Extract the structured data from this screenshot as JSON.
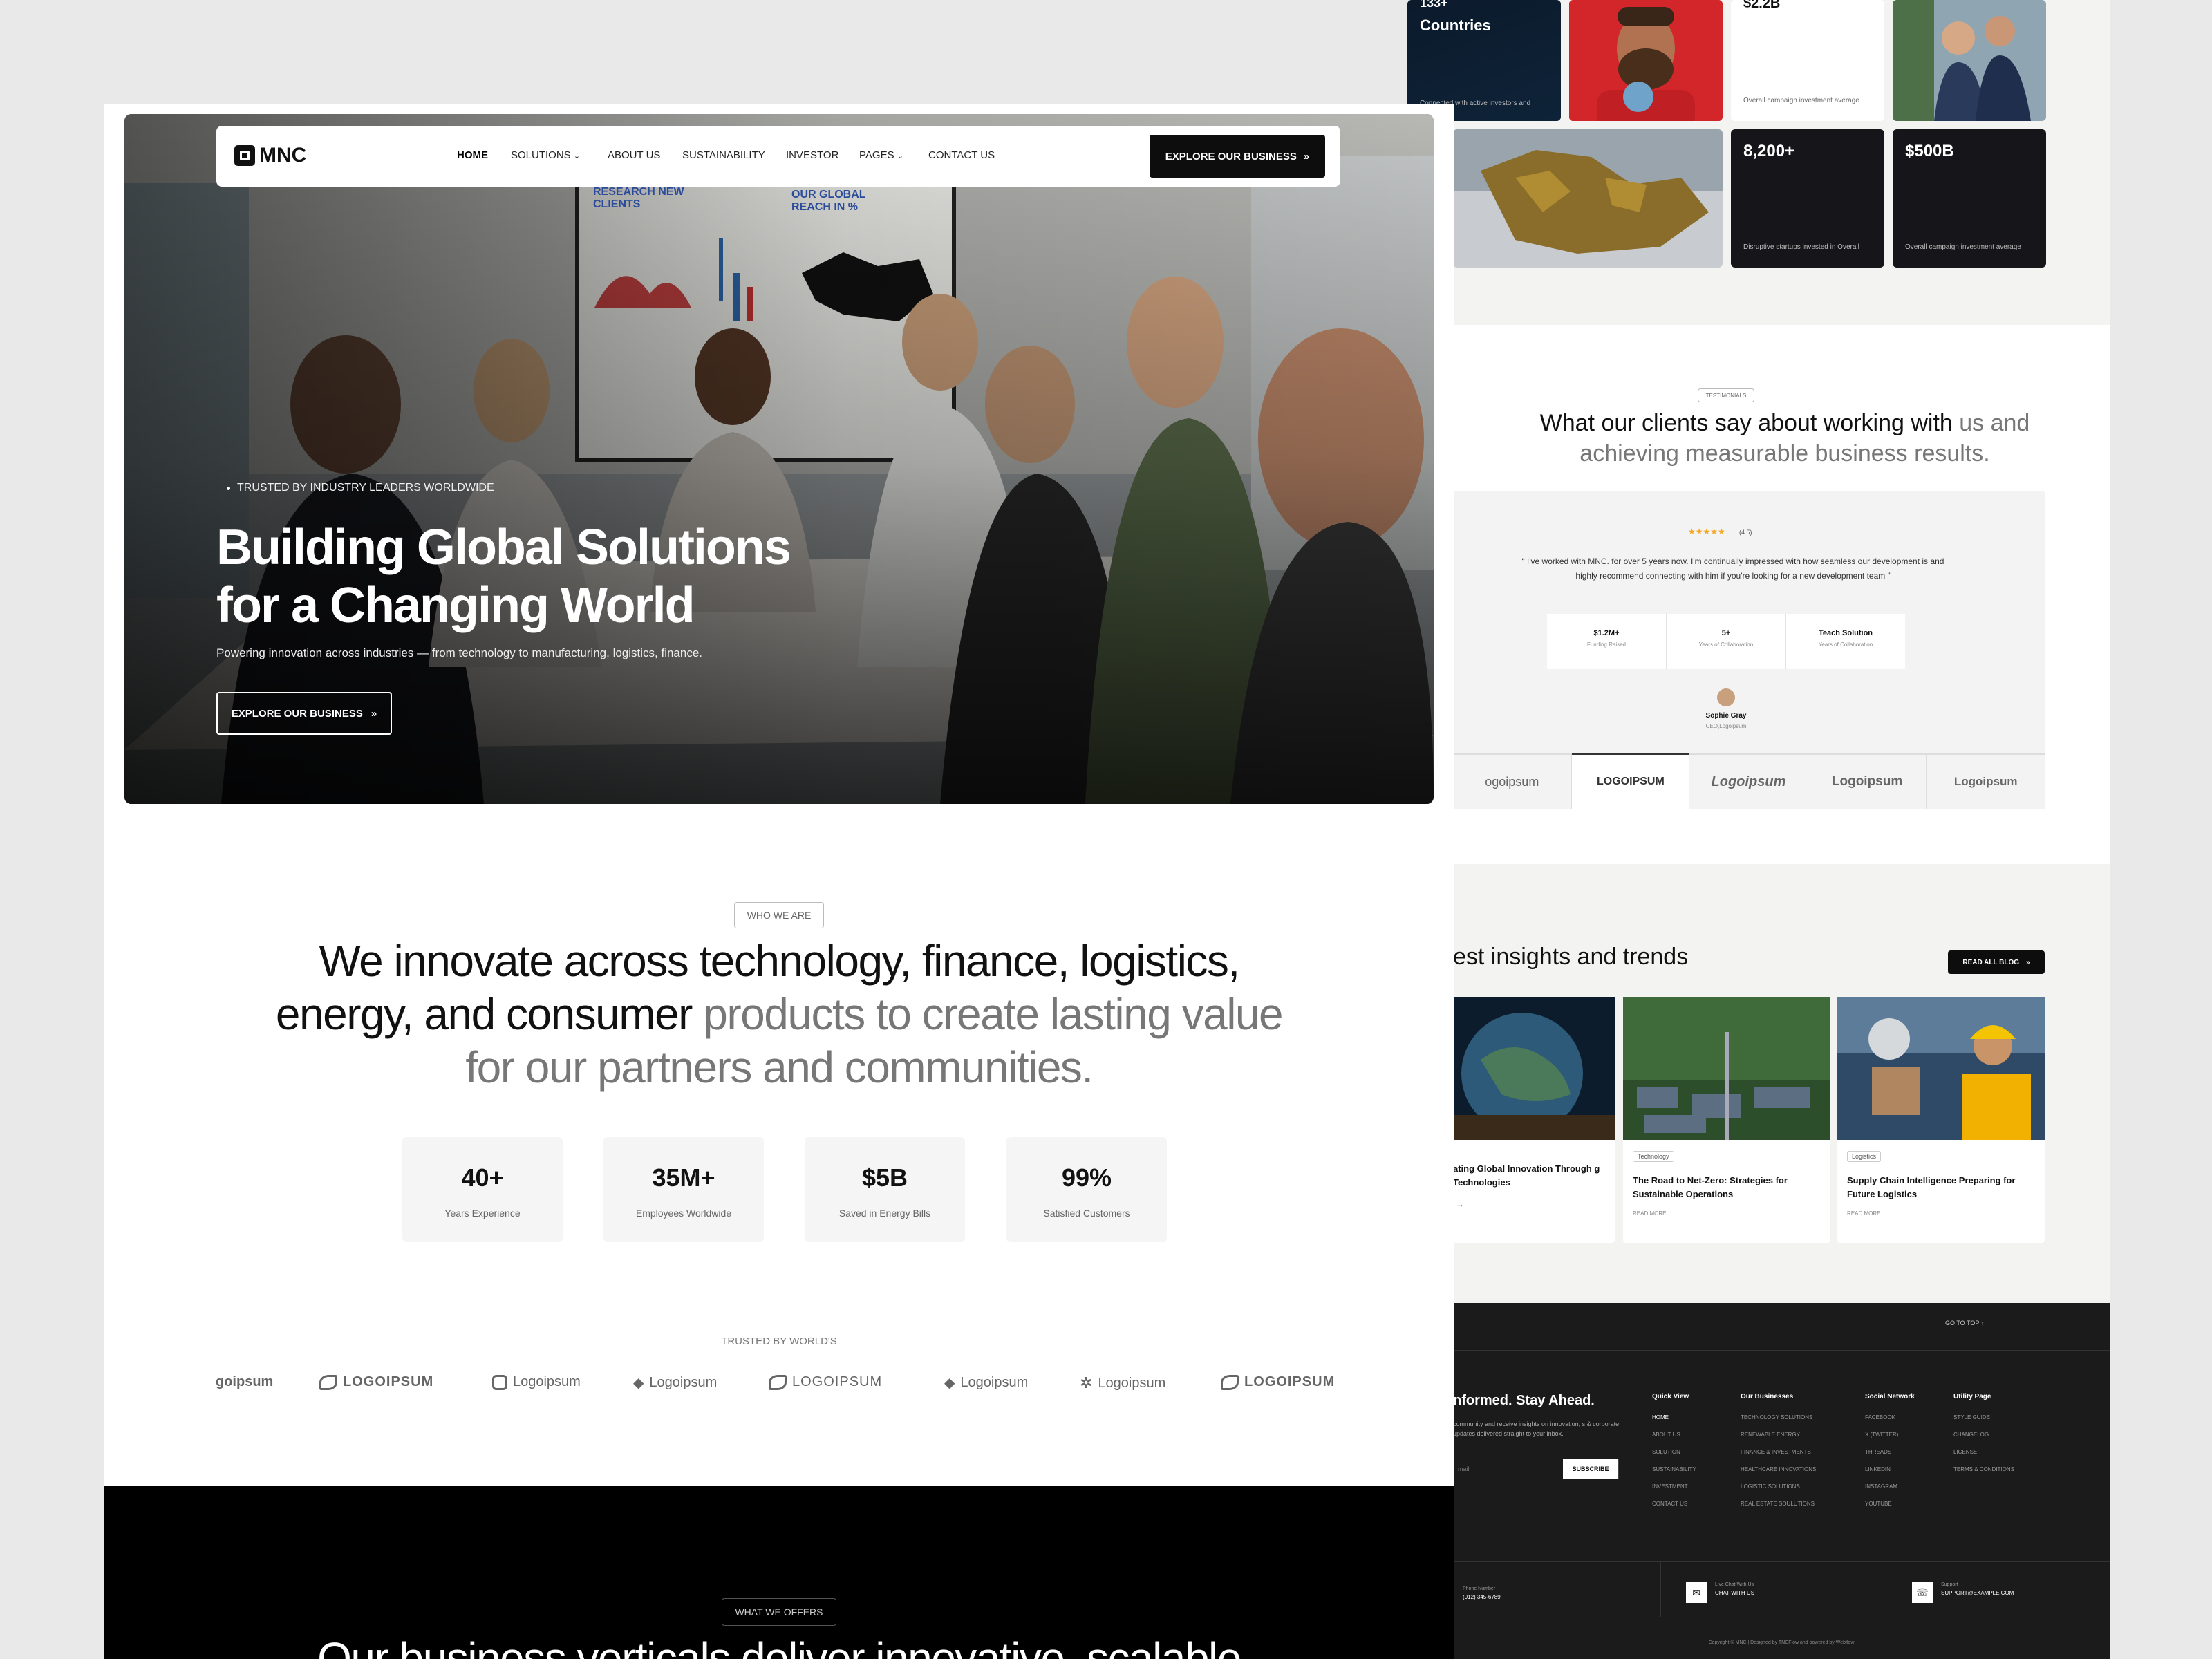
{
  "nav": {
    "brand": "MNC",
    "links": [
      "HOME",
      "SOLUTIONS",
      "ABOUT US",
      "SUSTAINABILITY",
      "INVESTOR",
      "PAGES",
      "CONTACT US"
    ],
    "cta": "EXPLORE OUR BUSINESS"
  },
  "hero": {
    "eyebrow": "TRUSTED BY INDUSTRY LEADERS WORLDWIDE",
    "title_line1": "Building Global Solutions",
    "title_line2": "for a Changing World",
    "subtitle": "Powering innovation across industries — from technology to manufacturing, logistics, finance.",
    "cta": "EXPLORE OUR BUSINESS",
    "board_text1": "RESEARCH NEW CLIENTS",
    "board_text2": "OUR GLOBAL REACH IN %"
  },
  "who": {
    "chip": "WHO WE ARE",
    "line1": "We innovate across technology, finance, logistics,",
    "line2_dark": "energy, and consumer ",
    "line2_light": "products to create lasting value",
    "line3": "for our partners and communities."
  },
  "stats": [
    {
      "value": "40+",
      "label": "Years Experience"
    },
    {
      "value": "35M+",
      "label": "Employees Worldwide"
    },
    {
      "value": "$5B",
      "label": "Saved in Energy Bills"
    },
    {
      "value": "99%",
      "label": "Satisfied Customers"
    }
  ],
  "trusted": {
    "label": "TRUSTED BY WORLD'S",
    "logos": [
      "goipsum",
      "LOGOIPSUM",
      "Logoipsum",
      "Logoipsum",
      "LOGOIPSUM",
      "Logoipsum",
      "Logoipsum",
      "LOGOIPSUM"
    ]
  },
  "offers": {
    "chip": "WHAT WE OFFERS",
    "title": "Our business verticals deliver innovative, scalable"
  },
  "right": {
    "tiles": [
      {
        "value": "133+",
        "label": "Countries",
        "sub": "Connected with active investors and founders"
      },
      {
        "value": "$2.2B",
        "sub": "Overall campaign investment average"
      },
      {
        "value": "8,200+",
        "sub": "Disruptive startups invested in Overall"
      },
      {
        "value": "$500B",
        "sub": "Overall campaign investment average"
      }
    ],
    "testimonials": {
      "chip": "TESTIMONIALS",
      "title_dark": "What our clients say about working with ",
      "title_light": "us and",
      "title_line2": "achieving measurable business results.",
      "rating": "(4.5)",
      "quote": "“ I've worked with MNC. for over 5 years now. I'm continually impressed with how seamless our development is and highly recommend connecting with him if you're looking for a new development team ”",
      "metrics": [
        {
          "value": "$1.2M+",
          "label": "Funding Raised"
        },
        {
          "value": "5+",
          "label": "Years of Collaboration"
        },
        {
          "value": "Teach Solution",
          "label": "Years of Collaboration"
        }
      ],
      "person": "Sophie Gray",
      "role": "CEO,Logoipsum",
      "logos": [
        "ogoipsum",
        "LOGOIPSUM",
        "Logoipsum",
        "Logoipsum",
        "Logoipsum"
      ]
    },
    "blog": {
      "title": "est insights and trends",
      "button": "READ ALL BLOG",
      "cards": [
        {
          "tag": "",
          "title": "ating Global Innovation Through g Technologies",
          "more": ""
        },
        {
          "tag": "Technology",
          "title": "The Road to Net-Zero: Strategies for Sustainable Operations",
          "more": "READ MORE"
        },
        {
          "tag": "Logistics",
          "title": "Supply Chain Intelligence Preparing for Future Logistics",
          "more": "READ MORE"
        }
      ]
    },
    "footer": {
      "goto": "GO TO TOP",
      "headline": "nformed. Stay Ahead.",
      "blurb": "community and receive insights on innovation, s & corporate updates delivered straight to your inbox.",
      "email_placeholder": "mail",
      "subscribe": "SUBSCRIBE",
      "cols": [
        {
          "title": "Quick View",
          "items": [
            "HOME",
            "ABOUT US",
            "SOLUTION",
            "SUSTAINABILITY",
            "INVESTMENT",
            "CONTACT US"
          ]
        },
        {
          "title": "Our Businesses",
          "items": [
            "TECHNOLOGY SOLUTIONS",
            "RENEWABLE ENERGY",
            "FINANCE & INVESTMENTS",
            "HEALTHCARE INNOVATIONS",
            "LOGISTIC SOLUTIONS",
            "REAL ESTATE SOULUTIONS"
          ]
        },
        {
          "title": "Social Network",
          "items": [
            "FACEBOOK",
            "X (TWITTER)",
            "THREADS",
            "LINKEDIN",
            "INSTAGRAM",
            "YOUTUBE"
          ]
        },
        {
          "title": "Utility Page",
          "items": [
            "STYLE GUIDE",
            "CHANGELOG",
            "LICENSE",
            "TERMS & CONDITIONS"
          ]
        }
      ],
      "contacts": [
        {
          "label": "Phone Number",
          "value": "(012) 345-6789"
        },
        {
          "label": "Live Chat With Us",
          "value": "CHAT WITH US"
        },
        {
          "label": "Support",
          "value": "SUPPORT@EXAMPLE.COM"
        }
      ],
      "copyright": "Copyright © MNC | Designed by TNCFlow and powered by Webflow"
    }
  }
}
